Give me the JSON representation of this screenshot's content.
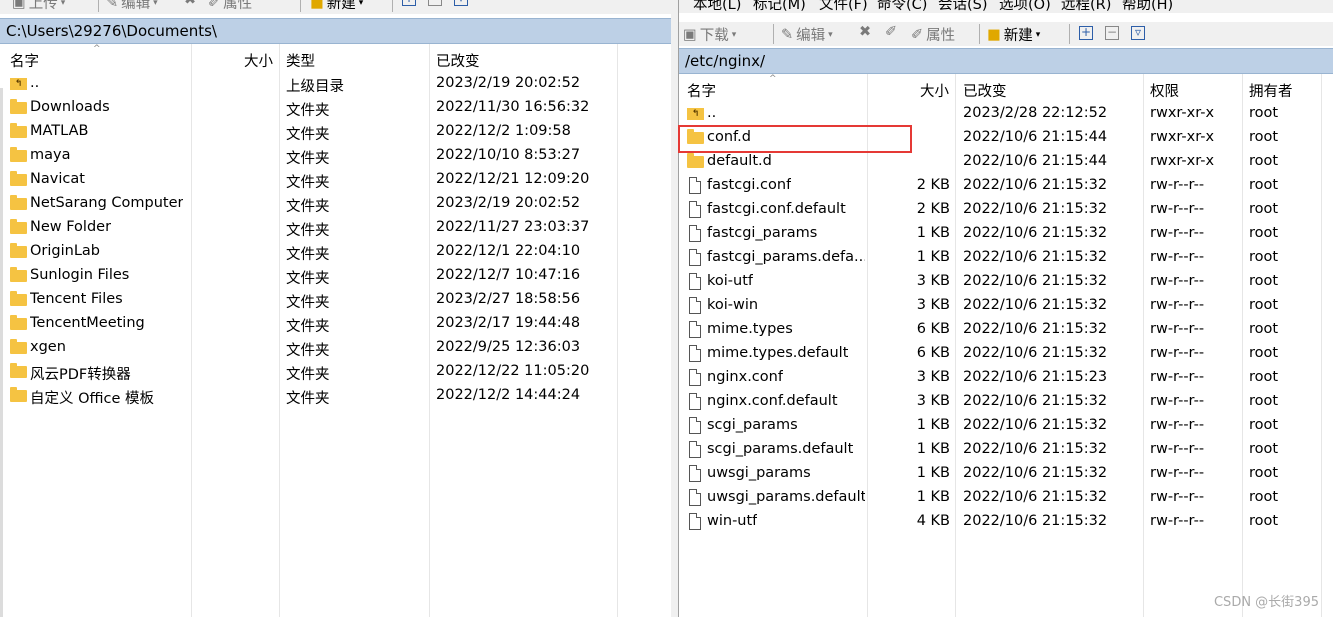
{
  "left": {
    "toolbar": {
      "upload": "上传",
      "edit": "编辑",
      "properties": "属性",
      "new": "新建"
    },
    "path": "C:\\Users\\29276\\Documents\\",
    "columns": {
      "name": "名字",
      "size": "大小",
      "type": "类型",
      "modified": "已改变"
    },
    "rows": [
      {
        "name": "..",
        "type": "上级目录",
        "modified": "2023/2/19  20:02:52",
        "icon": "up-dir"
      },
      {
        "name": "Downloads",
        "type": "文件夹",
        "modified": "2022/11/30  16:56:32",
        "icon": "folder"
      },
      {
        "name": "MATLAB",
        "type": "文件夹",
        "modified": "2022/12/2  1:09:58",
        "icon": "folder"
      },
      {
        "name": "maya",
        "type": "文件夹",
        "modified": "2022/10/10  8:53:27",
        "icon": "folder"
      },
      {
        "name": "Navicat",
        "type": "文件夹",
        "modified": "2022/12/21  12:09:20",
        "icon": "folder"
      },
      {
        "name": "NetSarang Computer",
        "type": "文件夹",
        "modified": "2023/2/19  20:02:52",
        "icon": "folder"
      },
      {
        "name": "New Folder",
        "type": "文件夹",
        "modified": "2022/11/27  23:03:37",
        "icon": "folder"
      },
      {
        "name": "OriginLab",
        "type": "文件夹",
        "modified": "2022/12/1  22:04:10",
        "icon": "folder"
      },
      {
        "name": "Sunlogin Files",
        "type": "文件夹",
        "modified": "2022/12/7  10:47:16",
        "icon": "folder"
      },
      {
        "name": "Tencent Files",
        "type": "文件夹",
        "modified": "2023/2/27  18:58:56",
        "icon": "folder"
      },
      {
        "name": "TencentMeeting",
        "type": "文件夹",
        "modified": "2023/2/17  19:44:48",
        "icon": "folder"
      },
      {
        "name": "xgen",
        "type": "文件夹",
        "modified": "2022/9/25  12:36:03",
        "icon": "folder"
      },
      {
        "name": "风云PDF转换器",
        "type": "文件夹",
        "modified": "2022/12/22  11:05:20",
        "icon": "folder"
      },
      {
        "name": "自定义 Office 模板",
        "type": "文件夹",
        "modified": "2022/12/2  14:44:24",
        "icon": "folder"
      }
    ]
  },
  "right": {
    "menu": {
      "local": "本地(L)",
      "mark": "标记(M)",
      "files": "文件(F)",
      "commands": "命令(C)",
      "session": "会话(S)",
      "options": "选项(O)",
      "remote": "远程(R)",
      "help": "帮助(H)"
    },
    "toolbar": {
      "download": "下载",
      "edit": "编辑",
      "properties": "属性",
      "new": "新建"
    },
    "path": "/etc/nginx/",
    "columns": {
      "name": "名字",
      "size": "大小",
      "modified": "已改变",
      "perms": "权限",
      "owner": "拥有者"
    },
    "rows": [
      {
        "name": "..",
        "size": "",
        "modified": "2023/2/28 22:12:52",
        "perms": "rwxr-xr-x",
        "owner": "root",
        "icon": "up-dir"
      },
      {
        "name": "conf.d",
        "size": "",
        "modified": "2022/10/6 21:15:44",
        "perms": "rwxr-xr-x",
        "owner": "root",
        "icon": "folder"
      },
      {
        "name": "default.d",
        "size": "",
        "modified": "2022/10/6 21:15:44",
        "perms": "rwxr-xr-x",
        "owner": "root",
        "icon": "folder"
      },
      {
        "name": "fastcgi.conf",
        "size": "2 KB",
        "modified": "2022/10/6 21:15:32",
        "perms": "rw-r--r--",
        "owner": "root",
        "icon": "file"
      },
      {
        "name": "fastcgi.conf.default",
        "size": "2 KB",
        "modified": "2022/10/6 21:15:32",
        "perms": "rw-r--r--",
        "owner": "root",
        "icon": "file"
      },
      {
        "name": "fastcgi_params",
        "size": "1 KB",
        "modified": "2022/10/6 21:15:32",
        "perms": "rw-r--r--",
        "owner": "root",
        "icon": "file"
      },
      {
        "name": "fastcgi_params.defa...",
        "size": "1 KB",
        "modified": "2022/10/6 21:15:32",
        "perms": "rw-r--r--",
        "owner": "root",
        "icon": "file"
      },
      {
        "name": "koi-utf",
        "size": "3 KB",
        "modified": "2022/10/6 21:15:32",
        "perms": "rw-r--r--",
        "owner": "root",
        "icon": "file"
      },
      {
        "name": "koi-win",
        "size": "3 KB",
        "modified": "2022/10/6 21:15:32",
        "perms": "rw-r--r--",
        "owner": "root",
        "icon": "file"
      },
      {
        "name": "mime.types",
        "size": "6 KB",
        "modified": "2022/10/6 21:15:32",
        "perms": "rw-r--r--",
        "owner": "root",
        "icon": "file"
      },
      {
        "name": "mime.types.default",
        "size": "6 KB",
        "modified": "2022/10/6 21:15:32",
        "perms": "rw-r--r--",
        "owner": "root",
        "icon": "file"
      },
      {
        "name": "nginx.conf",
        "size": "3 KB",
        "modified": "2022/10/6 21:15:23",
        "perms": "rw-r--r--",
        "owner": "root",
        "icon": "file"
      },
      {
        "name": "nginx.conf.default",
        "size": "3 KB",
        "modified": "2022/10/6 21:15:32",
        "perms": "rw-r--r--",
        "owner": "root",
        "icon": "file"
      },
      {
        "name": "scgi_params",
        "size": "1 KB",
        "modified": "2022/10/6 21:15:32",
        "perms": "rw-r--r--",
        "owner": "root",
        "icon": "file"
      },
      {
        "name": "scgi_params.default",
        "size": "1 KB",
        "modified": "2022/10/6 21:15:32",
        "perms": "rw-r--r--",
        "owner": "root",
        "icon": "file"
      },
      {
        "name": "uwsgi_params",
        "size": "1 KB",
        "modified": "2022/10/6 21:15:32",
        "perms": "rw-r--r--",
        "owner": "root",
        "icon": "file"
      },
      {
        "name": "uwsgi_params.default",
        "size": "1 KB",
        "modified": "2022/10/6 21:15:32",
        "perms": "rw-r--r--",
        "owner": "root",
        "icon": "file"
      },
      {
        "name": "win-utf",
        "size": "4 KB",
        "modified": "2022/10/6 21:15:32",
        "perms": "rw-r--r--",
        "owner": "root",
        "icon": "file"
      }
    ]
  },
  "watermark": "CSDN @长街395",
  "colors": {
    "pathbar": "#bdd0e6",
    "highlight": "#e53935",
    "folder": "#f5c342"
  }
}
